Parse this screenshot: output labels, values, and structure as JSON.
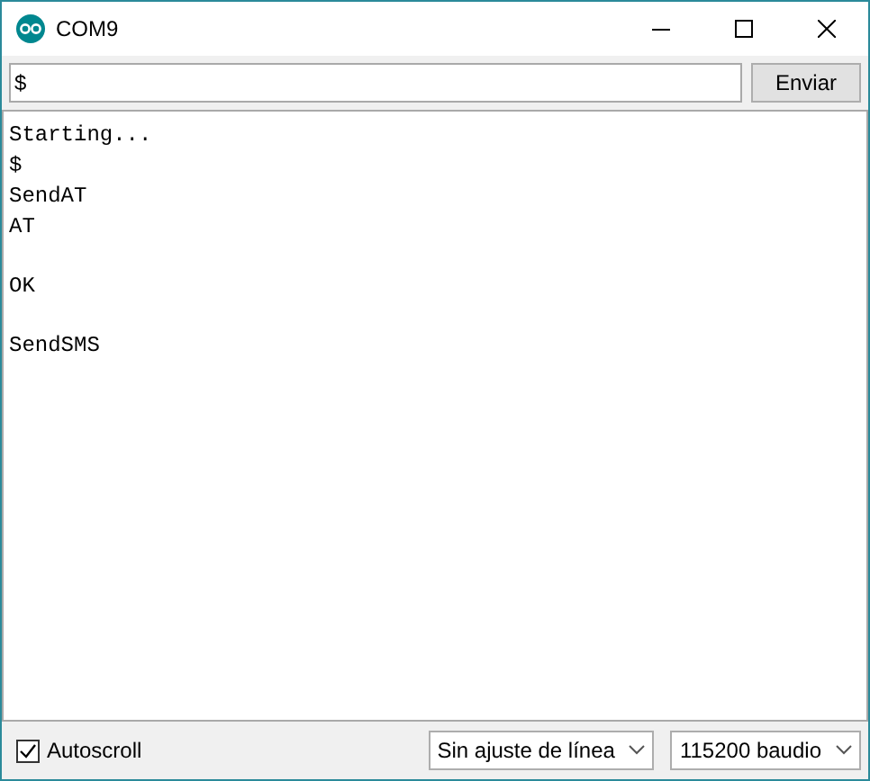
{
  "window": {
    "title": "COM9"
  },
  "input": {
    "value": "$"
  },
  "send_button": {
    "label": "Enviar"
  },
  "output_lines": [
    {
      "text": "Starting...",
      "blank_before": false
    },
    {
      "text": "$",
      "blank_before": false
    },
    {
      "text": "SendAT",
      "blank_before": false
    },
    {
      "text": "AT",
      "blank_before": false
    },
    {
      "text": "OK",
      "blank_before": true
    },
    {
      "text": "SendSMS",
      "blank_before": true
    }
  ],
  "autoscroll": {
    "label": "Autoscroll",
    "checked": true
  },
  "line_ending": {
    "value": "Sin ajuste de línea"
  },
  "baud_rate": {
    "value": "115200 baudio"
  }
}
